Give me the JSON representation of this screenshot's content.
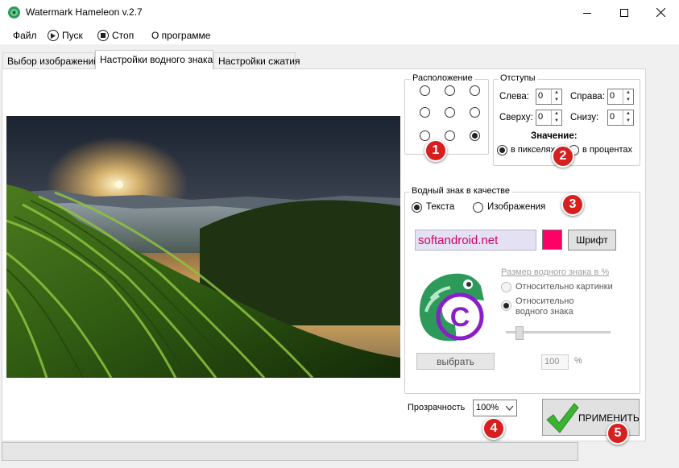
{
  "window": {
    "title": "Watermark Hameleon v.2.7",
    "minimize_icon": "minimize-icon",
    "maximize_icon": "maximize-icon",
    "close_icon": "close-icon"
  },
  "menu": {
    "file": "Файл",
    "start": "Пуск",
    "stop": "Стоп",
    "about": "О программе"
  },
  "tabs": [
    {
      "label": "Выбор изображений",
      "active": false
    },
    {
      "label": "Настройки водного знака",
      "active": true
    },
    {
      "label": "Настройки сжатия",
      "active": false
    }
  ],
  "position": {
    "title": "Расположение",
    "selected": "bottom-right"
  },
  "margins": {
    "title": "Отступы",
    "left_label": "Слева:",
    "left_value": "0",
    "right_label": "Справа:",
    "right_value": "0",
    "top_label": "Сверху:",
    "top_value": "0",
    "bottom_label": "Снизу:",
    "bottom_value": "0",
    "value_heading": "Значение:",
    "pixels_label": "в пикселях",
    "percent_label": "в процентах",
    "selected_unit": "pixels"
  },
  "watermark_type": {
    "title": "Водный знак в качестве",
    "text_label": "Текста",
    "image_label": "Изображения",
    "selected": "text"
  },
  "text_settings": {
    "text_value": "softandroid.net",
    "color": "#ff0066",
    "font_button": "Шрифт"
  },
  "image_settings": {
    "size_link": "Размер водного знака в %",
    "relative_picture": "Относительно картинки",
    "relative_watermark": "Относительно водного знака",
    "choose_button": "выбрать",
    "percent_value": "100",
    "percent_unit": "%",
    "slider_fraction": 0.1
  },
  "opacity": {
    "label": "Прозрачность",
    "value": "100%"
  },
  "apply_button": "ПРИМЕНИТЬ",
  "badges": [
    "1",
    "2",
    "3",
    "4",
    "5"
  ],
  "colors": {
    "badge": "#d6201f",
    "link_disabled": "#a0a0a0",
    "check": "#3cb332"
  }
}
